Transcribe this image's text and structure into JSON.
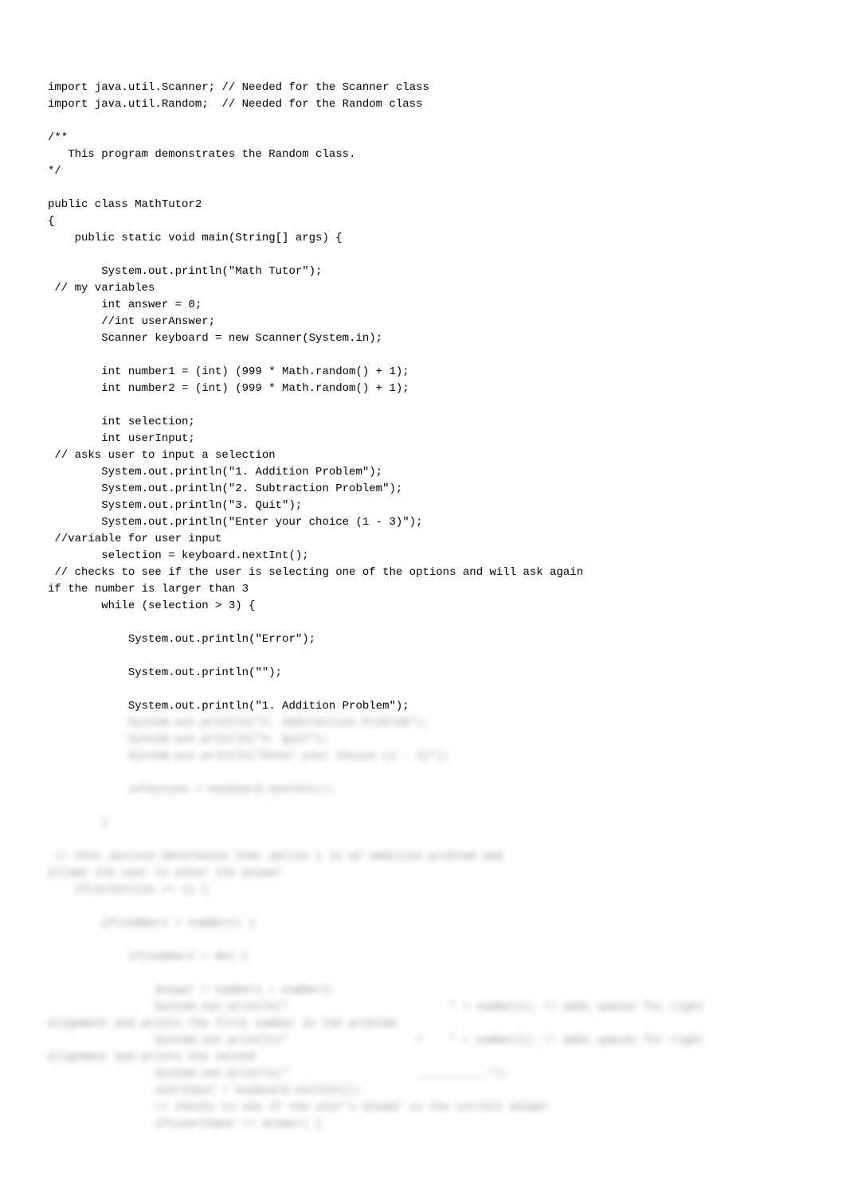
{
  "code_lines": [
    "import java.util.Scanner; // Needed for the Scanner class",
    "import java.util.Random;  // Needed for the Random class",
    "",
    "/**",
    "   This program demonstrates the Random class.",
    "*/",
    "",
    "public class MathTutor2",
    "{",
    "    public static void main(String[] args) {",
    "",
    "        System.out.println(\"Math Tutor\");",
    " // my variables",
    "        int answer = 0;",
    "        //int userAnswer;",
    "        Scanner keyboard = new Scanner(System.in);",
    "",
    "        int number1 = (int) (999 * Math.random() + 1);",
    "        int number2 = (int) (999 * Math.random() + 1);",
    "",
    "        int selection;",
    "        int userInput;",
    " // asks user to input a selection",
    "        System.out.println(\"1. Addition Problem\");",
    "        System.out.println(\"2. Subtraction Problem\");",
    "        System.out.println(\"3. Quit\");",
    "        System.out.println(\"Enter your choice (1 - 3)\");",
    " //variable for user input",
    "        selection = keyboard.nextInt();",
    " // checks to see if the user is selecting one of the options and will ask again",
    "if the number is larger than 3",
    "        while (selection > 3) {",
    "",
    "            System.out.println(\"Error\");",
    "",
    "            System.out.println(\"\");",
    "",
    "            System.out.println(\"1. Addition Problem\");"
  ],
  "blurred_lines": [
    "            System.out.println(\"2. Subtraction Problem\");",
    "            System.out.println(\"3. Quit\");",
    "            System.out.println(\"Enter your choice (1 - 3)\");",
    "",
    "            selection = keyboard.nextInt();",
    "",
    "        }",
    "",
    " // this section determines that option 1 is an addition problem and",
    "allows the user to enter the answer",
    "    if(selection == 1) {",
    "",
    "        if(number1 > number2) {",
    "",
    "            if(number2 > 99) {",
    "",
    "                answer = number1 + number2;",
    "                System.out.println(\"                        \" + number1); // adds spaces for right",
    "alignment and prints the first number in the problem",
    "                System.out.println(\"                   +    \" + number2); // adds spaces for right",
    "alignment and prints the second",
    "                System.out.println(\"                   ___________\");",
    "                userInput = keyboard.nextInt();",
    "                // checks to see if the user's answer is the correct answer",
    "                if(userInput == answer) {"
  ]
}
